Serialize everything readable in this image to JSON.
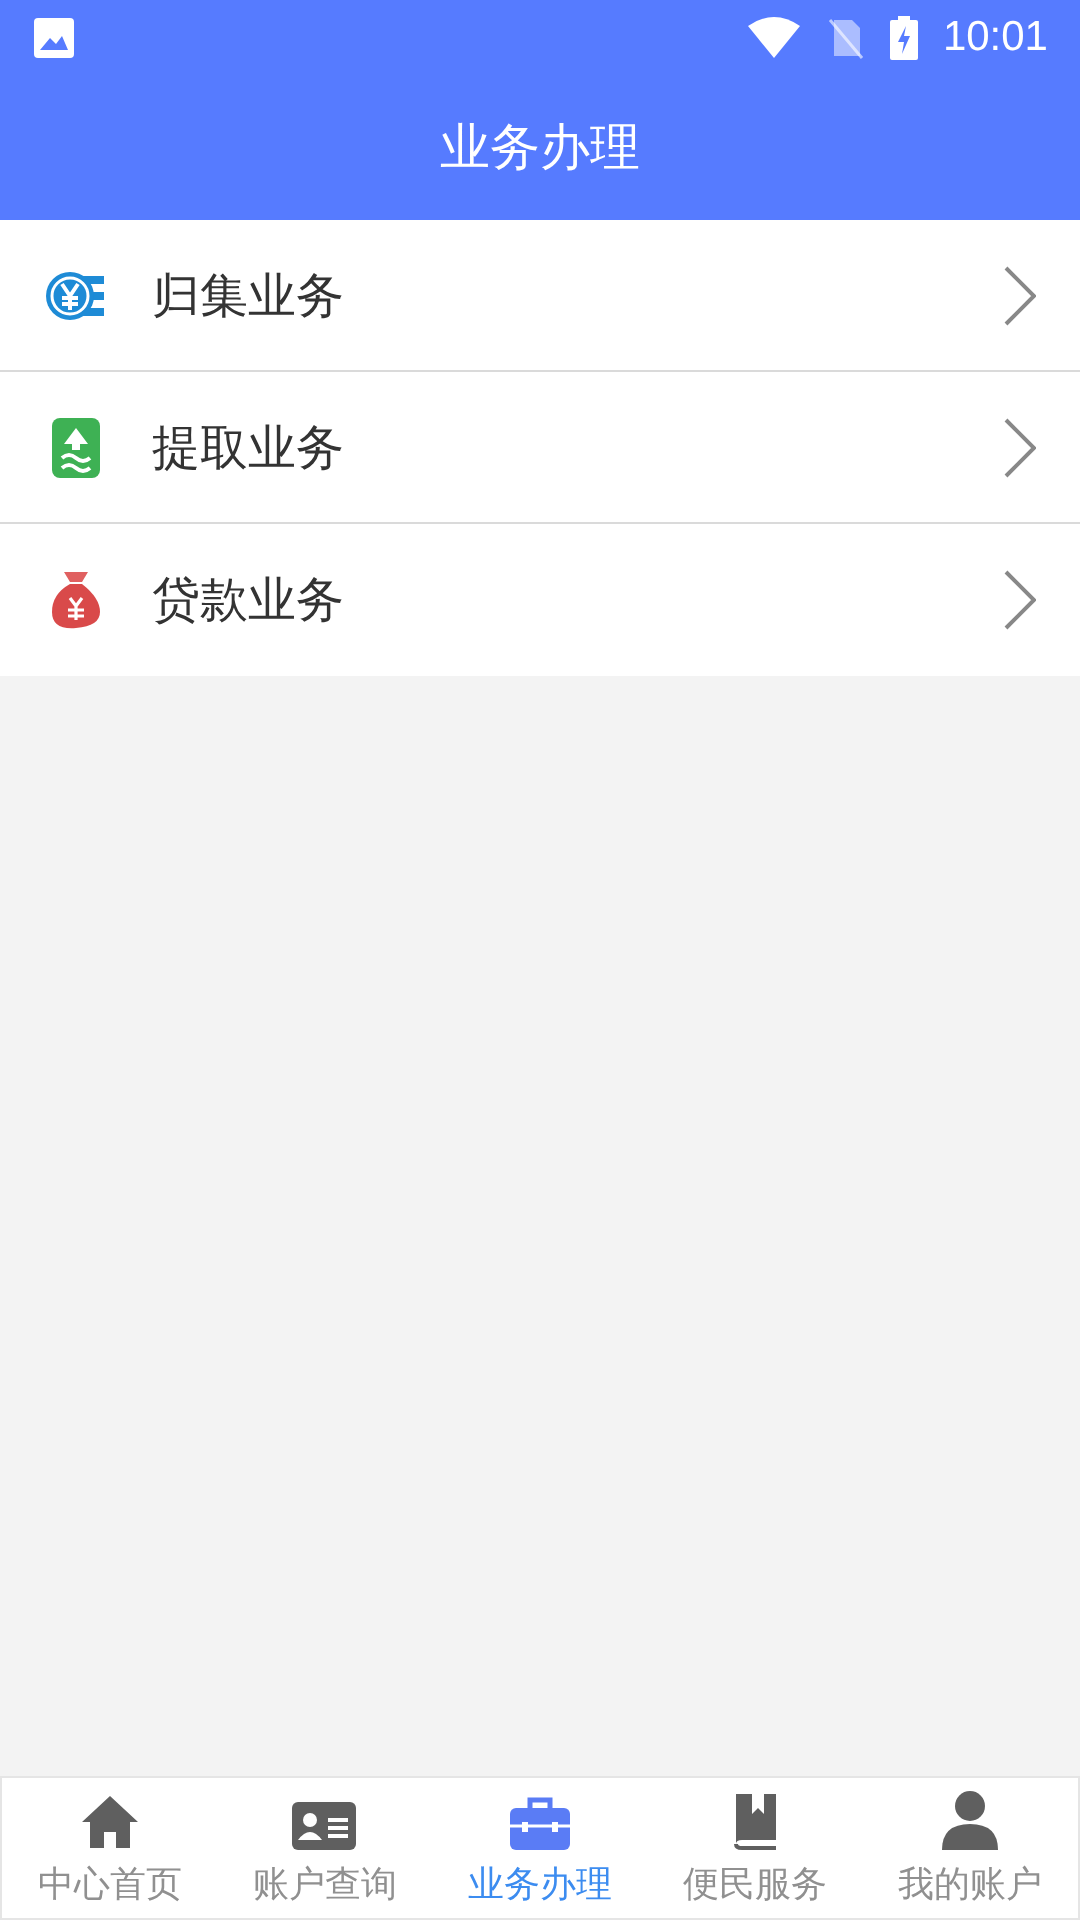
{
  "status_bar": {
    "time": "10:01"
  },
  "header": {
    "title": "业务办理"
  },
  "menu": [
    {
      "label": "归集业务",
      "kind": "coin"
    },
    {
      "label": "提取业务",
      "kind": "withdraw"
    },
    {
      "label": "贷款业务",
      "kind": "bag"
    }
  ],
  "tabs": [
    {
      "label": "中心首页",
      "kind": "home",
      "selected": false
    },
    {
      "label": "账户查询",
      "kind": "card",
      "selected": false
    },
    {
      "label": "业务办理",
      "kind": "briefcase",
      "selected": true
    },
    {
      "label": "便民服务",
      "kind": "book",
      "selected": false
    },
    {
      "label": "我的账户",
      "kind": "user",
      "selected": false
    }
  ]
}
